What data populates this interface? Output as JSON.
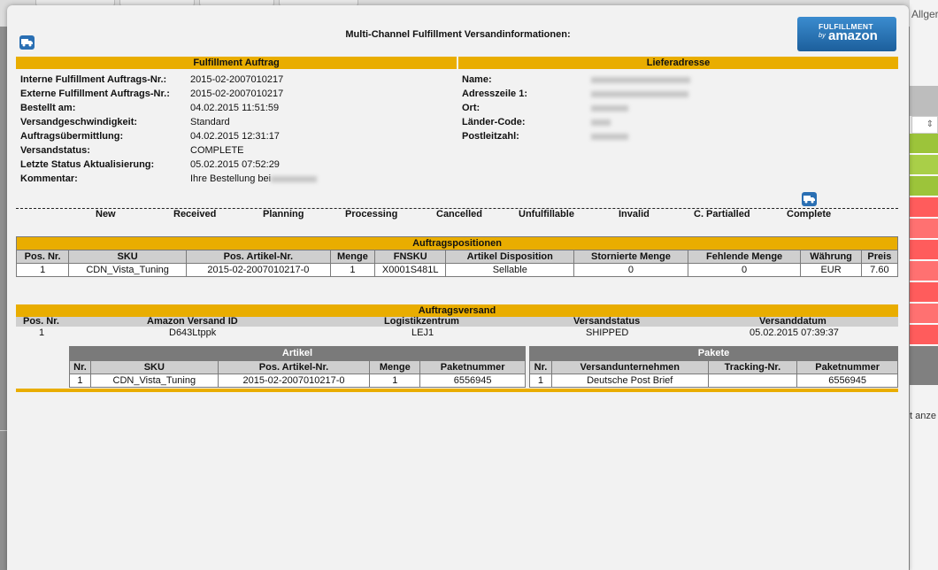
{
  "background": {
    "tab_label": "Allger",
    "select_arrow": "⇕",
    "side_text": "t anze",
    "status_colors": [
      "#9cc43a",
      "#a9cf48",
      "#9cc43a",
      "#ff5c5c",
      "#ff7171",
      "#ff5c5c",
      "#ff7171",
      "#ff5c5c",
      "#ff7171",
      "#ff5c5c",
      "#a9cf48"
    ]
  },
  "modal": {
    "title": "Multi-Channel Fulfillment Versandinformationen:",
    "logo": {
      "line1": "FULFILLMENT",
      "line2": "by",
      "line3": "amazon"
    },
    "truck_icon": "truck-icon"
  },
  "order": {
    "header": "Fulfillment Auftrag",
    "rows": [
      {
        "label": "Interne Fulfillment Auftrags-Nr.:",
        "value": "2015-02-2007010217"
      },
      {
        "label": "Externe Fulfillment Auftrags-Nr.:",
        "value": "2015-02-2007010217"
      },
      {
        "label": "Bestellt am:",
        "value": "04.02.2015 11:51:59"
      },
      {
        "label": "Versandgeschwindigkeit:",
        "value": "Standard"
      },
      {
        "label": "Auftragsübermittlung:",
        "value": "04.02.2015 12:31:17"
      },
      {
        "label": "Versandstatus:",
        "value": "COMPLETE"
      },
      {
        "label": "Letzte Status Aktualisierung:",
        "value": "05.02.2015 07:52:29"
      },
      {
        "label": "Kommentar:",
        "value": "Ihre Bestellung bei"
      }
    ]
  },
  "address": {
    "header": "Lieferadresse",
    "rows": [
      {
        "label": "Name:"
      },
      {
        "label": "Adresszeile 1:"
      },
      {
        "label": "Ort:"
      },
      {
        "label": "Länder-Code:"
      },
      {
        "label": "Postleitzahl:"
      }
    ]
  },
  "stages": [
    "New",
    "Received",
    "Planning",
    "Processing",
    "Cancelled",
    "Unfulfillable",
    "Invalid",
    "C. Partialled",
    "Complete"
  ],
  "positions": {
    "caption": "Auftragspositionen",
    "columns": [
      "Pos. Nr.",
      "SKU",
      "Pos. Artikel-Nr.",
      "Menge",
      "FNSKU",
      "Artikel Disposition",
      "Stornierte Menge",
      "Fehlende Menge",
      "Währung",
      "Preis"
    ],
    "rows": [
      [
        "1",
        "CDN_Vista_Tuning",
        "2015-02-2007010217-0",
        "1",
        "X0001S481L",
        "Sellable",
        "0",
        "0",
        "EUR",
        "7.60"
      ]
    ]
  },
  "shipment": {
    "caption": "Auftragsversand",
    "columns": [
      "Pos. Nr.",
      "Amazon Versand ID",
      "Logistikzentrum",
      "Versandstatus",
      "Versanddatum"
    ],
    "row": [
      "1",
      "D643Ltppk",
      "LEJ1",
      "SHIPPED",
      "05.02.2015 07:39:37"
    ]
  },
  "articles": {
    "caption": "Artikel",
    "columns": [
      "Nr.",
      "SKU",
      "Pos. Artikel-Nr.",
      "Menge",
      "Paketnummer"
    ],
    "rows": [
      [
        "1",
        "CDN_Vista_Tuning",
        "2015-02-2007010217-0",
        "1",
        "6556945"
      ]
    ]
  },
  "packages": {
    "caption": "Pakete",
    "columns": [
      "Nr.",
      "Versandunternehmen",
      "Tracking-Nr.",
      "Paketnummer"
    ],
    "rows": [
      [
        "1",
        "Deutsche Post Brief",
        "",
        "6556945"
      ]
    ]
  }
}
